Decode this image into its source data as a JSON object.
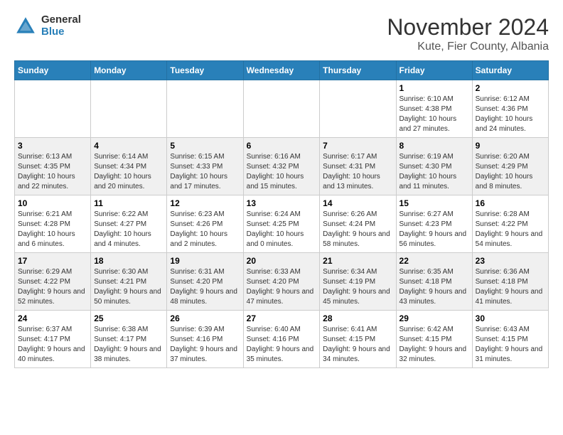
{
  "logo": {
    "general": "General",
    "blue": "Blue"
  },
  "title": "November 2024",
  "location": "Kute, Fier County, Albania",
  "days_of_week": [
    "Sunday",
    "Monday",
    "Tuesday",
    "Wednesday",
    "Thursday",
    "Friday",
    "Saturday"
  ],
  "weeks": [
    [
      {
        "day": "",
        "info": ""
      },
      {
        "day": "",
        "info": ""
      },
      {
        "day": "",
        "info": ""
      },
      {
        "day": "",
        "info": ""
      },
      {
        "day": "",
        "info": ""
      },
      {
        "day": "1",
        "info": "Sunrise: 6:10 AM\nSunset: 4:38 PM\nDaylight: 10 hours and 27 minutes."
      },
      {
        "day": "2",
        "info": "Sunrise: 6:12 AM\nSunset: 4:36 PM\nDaylight: 10 hours and 24 minutes."
      }
    ],
    [
      {
        "day": "3",
        "info": "Sunrise: 6:13 AM\nSunset: 4:35 PM\nDaylight: 10 hours and 22 minutes."
      },
      {
        "day": "4",
        "info": "Sunrise: 6:14 AM\nSunset: 4:34 PM\nDaylight: 10 hours and 20 minutes."
      },
      {
        "day": "5",
        "info": "Sunrise: 6:15 AM\nSunset: 4:33 PM\nDaylight: 10 hours and 17 minutes."
      },
      {
        "day": "6",
        "info": "Sunrise: 6:16 AM\nSunset: 4:32 PM\nDaylight: 10 hours and 15 minutes."
      },
      {
        "day": "7",
        "info": "Sunrise: 6:17 AM\nSunset: 4:31 PM\nDaylight: 10 hours and 13 minutes."
      },
      {
        "day": "8",
        "info": "Sunrise: 6:19 AM\nSunset: 4:30 PM\nDaylight: 10 hours and 11 minutes."
      },
      {
        "day": "9",
        "info": "Sunrise: 6:20 AM\nSunset: 4:29 PM\nDaylight: 10 hours and 8 minutes."
      }
    ],
    [
      {
        "day": "10",
        "info": "Sunrise: 6:21 AM\nSunset: 4:28 PM\nDaylight: 10 hours and 6 minutes."
      },
      {
        "day": "11",
        "info": "Sunrise: 6:22 AM\nSunset: 4:27 PM\nDaylight: 10 hours and 4 minutes."
      },
      {
        "day": "12",
        "info": "Sunrise: 6:23 AM\nSunset: 4:26 PM\nDaylight: 10 hours and 2 minutes."
      },
      {
        "day": "13",
        "info": "Sunrise: 6:24 AM\nSunset: 4:25 PM\nDaylight: 10 hours and 0 minutes."
      },
      {
        "day": "14",
        "info": "Sunrise: 6:26 AM\nSunset: 4:24 PM\nDaylight: 9 hours and 58 minutes."
      },
      {
        "day": "15",
        "info": "Sunrise: 6:27 AM\nSunset: 4:23 PM\nDaylight: 9 hours and 56 minutes."
      },
      {
        "day": "16",
        "info": "Sunrise: 6:28 AM\nSunset: 4:22 PM\nDaylight: 9 hours and 54 minutes."
      }
    ],
    [
      {
        "day": "17",
        "info": "Sunrise: 6:29 AM\nSunset: 4:22 PM\nDaylight: 9 hours and 52 minutes."
      },
      {
        "day": "18",
        "info": "Sunrise: 6:30 AM\nSunset: 4:21 PM\nDaylight: 9 hours and 50 minutes."
      },
      {
        "day": "19",
        "info": "Sunrise: 6:31 AM\nSunset: 4:20 PM\nDaylight: 9 hours and 48 minutes."
      },
      {
        "day": "20",
        "info": "Sunrise: 6:33 AM\nSunset: 4:20 PM\nDaylight: 9 hours and 47 minutes."
      },
      {
        "day": "21",
        "info": "Sunrise: 6:34 AM\nSunset: 4:19 PM\nDaylight: 9 hours and 45 minutes."
      },
      {
        "day": "22",
        "info": "Sunrise: 6:35 AM\nSunset: 4:18 PM\nDaylight: 9 hours and 43 minutes."
      },
      {
        "day": "23",
        "info": "Sunrise: 6:36 AM\nSunset: 4:18 PM\nDaylight: 9 hours and 41 minutes."
      }
    ],
    [
      {
        "day": "24",
        "info": "Sunrise: 6:37 AM\nSunset: 4:17 PM\nDaylight: 9 hours and 40 minutes."
      },
      {
        "day": "25",
        "info": "Sunrise: 6:38 AM\nSunset: 4:17 PM\nDaylight: 9 hours and 38 minutes."
      },
      {
        "day": "26",
        "info": "Sunrise: 6:39 AM\nSunset: 4:16 PM\nDaylight: 9 hours and 37 minutes."
      },
      {
        "day": "27",
        "info": "Sunrise: 6:40 AM\nSunset: 4:16 PM\nDaylight: 9 hours and 35 minutes."
      },
      {
        "day": "28",
        "info": "Sunrise: 6:41 AM\nSunset: 4:15 PM\nDaylight: 9 hours and 34 minutes."
      },
      {
        "day": "29",
        "info": "Sunrise: 6:42 AM\nSunset: 4:15 PM\nDaylight: 9 hours and 32 minutes."
      },
      {
        "day": "30",
        "info": "Sunrise: 6:43 AM\nSunset: 4:15 PM\nDaylight: 9 hours and 31 minutes."
      }
    ]
  ]
}
